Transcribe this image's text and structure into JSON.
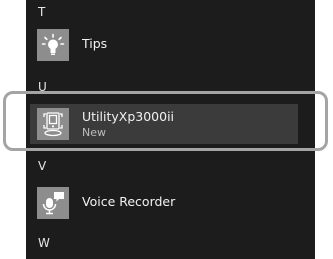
{
  "sections": [
    {
      "letter": "T"
    },
    {
      "letter": "U"
    },
    {
      "letter": "V"
    },
    {
      "letter": "W"
    }
  ],
  "apps": [
    {
      "name": "Tips",
      "icon": "lightbulb-icon"
    },
    {
      "name": "UtilityXp3000ii",
      "status": "New",
      "icon": "utility-app-icon"
    },
    {
      "name": "Voice Recorder",
      "icon": "microphone-icon"
    }
  ],
  "colors": {
    "panel_bg": "#1c1c1c",
    "selected_bg": "#3b3b3b",
    "tile_gray": "#8d8d8d",
    "highlight_outline": "#a4a4a4"
  }
}
